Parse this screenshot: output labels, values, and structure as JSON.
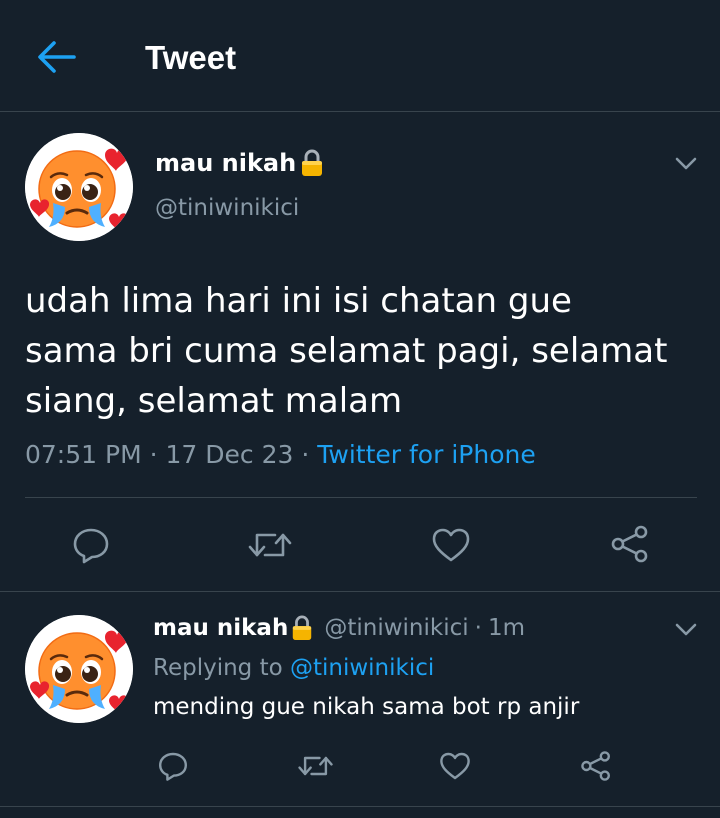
{
  "colors": {
    "background": "#15202b",
    "divider": "#38444d",
    "secondary_text": "#8899a6",
    "accent": "#1da1f2",
    "lock": "#f5b400"
  },
  "header": {
    "back_icon": "arrow-left-icon",
    "title": "Tweet"
  },
  "tweet": {
    "avatar_emoji": "pleading-face-hearts",
    "display_name": "mau nikah",
    "lock_icon": "lock-icon",
    "handle": "@tiniwinikici",
    "text_lines": [
      "udah lima hari ini isi chatan gue",
      "sama bri cuma selamat pagi, selamat",
      "siang, selamat malam"
    ],
    "time": "07:51 PM",
    "separator": "·",
    "date": "17 Dec 23",
    "source": "Twitter for iPhone",
    "actions": [
      "reply-icon",
      "retweet-icon",
      "like-icon",
      "share-icon"
    ]
  },
  "reply": {
    "display_name": "mau nikah",
    "handle": "@tiniwinikici",
    "separator": "·",
    "time": "1m",
    "replying_prefix": "Replying to",
    "replying_to": "@tiniwinikici",
    "text": "mending gue nikah sama bot rp anjir",
    "actions": [
      "reply-icon",
      "retweet-icon",
      "like-icon",
      "share-icon"
    ]
  }
}
